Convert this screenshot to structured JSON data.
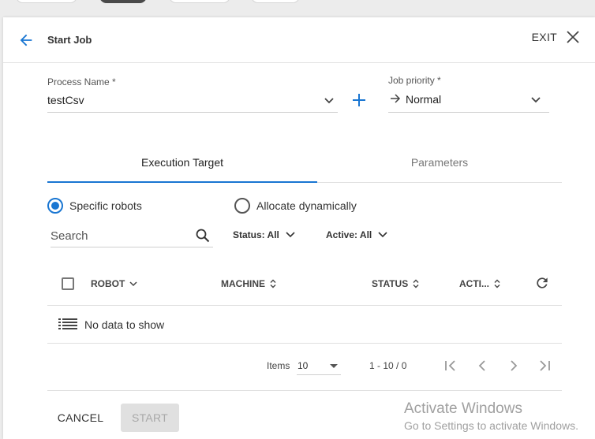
{
  "header": {
    "title": "Start Job",
    "exit_label": "EXIT"
  },
  "process_field": {
    "label": "Process Name *",
    "value": "testCsv"
  },
  "priority_field": {
    "label": "Job priority *",
    "value": "Normal"
  },
  "tabs": [
    {
      "label": "Execution Target",
      "active": true
    },
    {
      "label": "Parameters",
      "active": false
    }
  ],
  "target_options": [
    {
      "label": "Specific robots",
      "selected": true
    },
    {
      "label": "Allocate dynamically",
      "selected": false
    }
  ],
  "search": {
    "placeholder": "Search"
  },
  "filters": {
    "status": "Status: All",
    "active": "Active: All"
  },
  "table": {
    "columns": [
      "ROBOT",
      "MACHINE",
      "STATUS",
      "ACTI..."
    ],
    "empty_text": "No data to show"
  },
  "pagination": {
    "items_label": "Items",
    "page_size": "10",
    "range": "1 - 10 / 0"
  },
  "footer": {
    "cancel_label": "CANCEL",
    "start_label": "START"
  },
  "watermark": {
    "title": "Activate Windows",
    "subtitle": "Go to Settings to activate Windows."
  },
  "colors": {
    "accent": "#1976d2",
    "disabled_bg": "#e0e0e0"
  }
}
